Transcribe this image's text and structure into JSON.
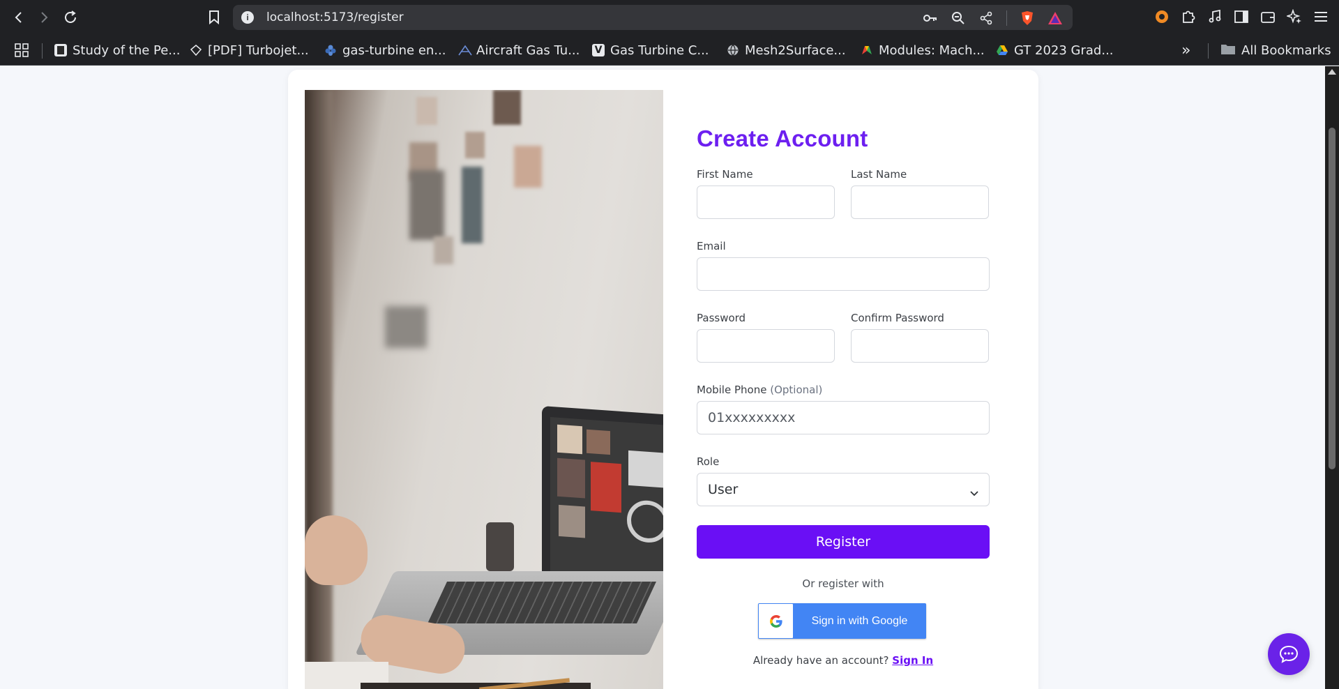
{
  "browser": {
    "url": "localhost:5173/register",
    "bookmarks": [
      {
        "label": "Study of the Pe...",
        "icon": "document-favicon"
      },
      {
        "label": "[PDF] Turbojet...",
        "icon": "diamond-favicon"
      },
      {
        "label": "gas-turbine en...",
        "icon": "blue-flower-favicon"
      },
      {
        "label": "Aircraft Gas Tu...",
        "icon": "wing-favicon"
      },
      {
        "label": "Gas Turbine C...",
        "icon": "v-favicon"
      },
      {
        "label": "Mesh2Surface...",
        "icon": "globe-favicon"
      },
      {
        "label": "Modules: Mach...",
        "icon": "colorful-favicon"
      },
      {
        "label": "GT 2023 Grad...",
        "icon": "drive-favicon"
      }
    ],
    "more_bookmarks": "»",
    "all_bookmarks": "All Bookmarks"
  },
  "form": {
    "title": "Create Account",
    "first_name_label": "First Name",
    "last_name_label": "Last Name",
    "email_label": "Email",
    "password_label": "Password",
    "confirm_password_label": "Confirm Password",
    "mobile_label": "Mobile Phone",
    "mobile_optional": "(Optional)",
    "mobile_placeholder": "01xxxxxxxxx",
    "role_label": "Role",
    "role_value": "User",
    "register_label": "Register",
    "or_register_with": "Or register with",
    "google_label": "Sign in with Google",
    "already_text": "Already have an account?",
    "sign_in_label": "Sign In"
  },
  "colors": {
    "accent": "#6a0ff5",
    "title": "#6d1ff0",
    "google": "#4285f4",
    "chat": "#6a22e8"
  }
}
